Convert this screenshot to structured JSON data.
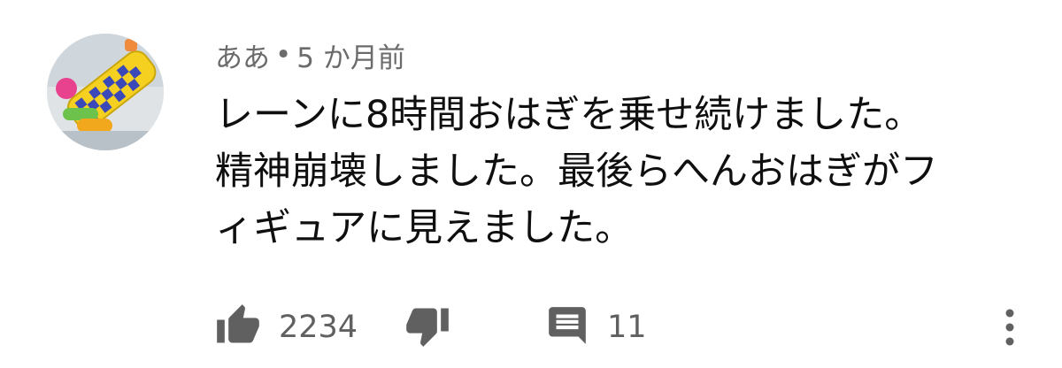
{
  "comment": {
    "author": "ああ",
    "separator": "•",
    "time": "5 か月前",
    "text_lines": [
      "レーンに8時間おはぎを乗せ続けました。",
      "精神崩壊しました。最後らへんおはぎがフ",
      "ィギュアに見えました。"
    ],
    "like_count": "2234",
    "reply_count": "11"
  },
  "icons": {
    "like": "thumb-up-icon",
    "dislike": "thumb-down-icon",
    "reply": "comment-icon",
    "more": "more-vertical-icon"
  },
  "colors": {
    "text": "#0f0f0f",
    "secondary": "#6b6b6b",
    "icon": "#606060"
  }
}
